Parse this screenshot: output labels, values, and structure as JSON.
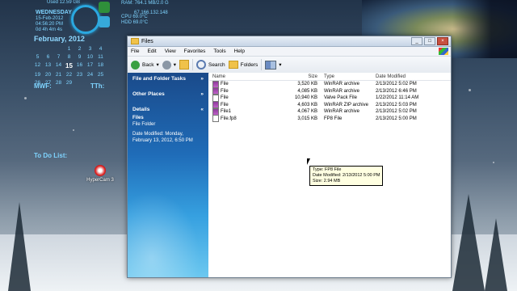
{
  "desktop": {
    "disk_used": "Used 12.59 GB",
    "system_stats": [
      "RAM: 764.1 MB/2.0 G",
      "",
      "CPU      69.0°C",
      "HDD      69.0°C"
    ],
    "ip": "67.166.132.148",
    "weekday": "WEDNESDAY",
    "date_lines": [
      "15-Feb-2012",
      "04:56:20 PM",
      "0d 4h 4m 4s"
    ],
    "calendar": {
      "title": "February, 2012",
      "rows": [
        [
          "",
          "",
          "",
          "1",
          "2",
          "3",
          "4"
        ],
        [
          "5",
          "6",
          "7",
          "8",
          "9",
          "10",
          "11"
        ],
        [
          "12",
          "13",
          "14",
          "15",
          "16",
          "17",
          "18"
        ],
        [
          "19",
          "20",
          "21",
          "22",
          "23",
          "24",
          "25"
        ],
        [
          "26",
          "27",
          "28",
          "29",
          "",
          "",
          ""
        ]
      ],
      "today": "15"
    },
    "label_mwf": "MWF:",
    "label_tth": "TTh:",
    "label_todo": "To Do List:",
    "icon_hypercam": "HyperCam 3"
  },
  "window": {
    "title": "Files",
    "menu": [
      "File",
      "Edit",
      "View",
      "Favorites",
      "Tools",
      "Help"
    ],
    "toolbar": {
      "back": "Back",
      "search": "Search",
      "folders": "Folders"
    },
    "left_panel": {
      "section1": "File and Folder Tasks",
      "section2": "Other Places",
      "section3": "Details",
      "details_name": "Files",
      "details_type": "File Folder",
      "details_modified": "Date Modified: Monday, February 13, 2012, 6:50 PM"
    },
    "columns": [
      "Name",
      "Size",
      "Type",
      "Date Modified"
    ],
    "files": [
      {
        "name": "File",
        "size": "3,520 KB",
        "type": "WinRAR archive",
        "date": "2/13/2012 5:02 PM",
        "icon": "rar"
      },
      {
        "name": "File",
        "size": "4,085 KB",
        "type": "WinRAR archive",
        "date": "2/13/2012 6:46 PM",
        "icon": "rar"
      },
      {
        "name": "File",
        "size": "10,940 KB",
        "type": "Valve Pack File",
        "date": "1/22/2012 11:14 AM",
        "icon": "plain"
      },
      {
        "name": "File",
        "size": "4,603 KB",
        "type": "WinRAR ZIP archive",
        "date": "2/13/2012 5:03 PM",
        "icon": "rar"
      },
      {
        "name": "File1",
        "size": "4,067 KB",
        "type": "WinRAR archive",
        "date": "2/13/2012 5:02 PM",
        "icon": "rar"
      },
      {
        "name": "File.fp8",
        "size": "3,015 KB",
        "type": "FP8 File",
        "date": "2/13/2012 5:00 PM",
        "icon": "plain"
      }
    ],
    "tooltip": [
      "Type: FP8 File",
      "Date Modified: 2/13/2012 5:00 PM",
      "Size: 2.94 MB"
    ]
  }
}
